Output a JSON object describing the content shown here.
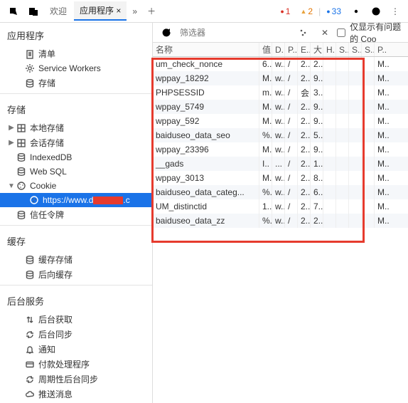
{
  "toolbar": {
    "tab_welcome": "欢迎",
    "tab_app": "应用程序",
    "tab_close": "×",
    "err_count": "1",
    "warn_count": "2",
    "msg_count": "33"
  },
  "sidebar": {
    "app": {
      "title": "应用程序",
      "items": [
        {
          "label": "清单",
          "icon": "manifest"
        },
        {
          "label": "Service Workers",
          "icon": "gear"
        },
        {
          "label": "存储",
          "icon": "db"
        }
      ]
    },
    "storage": {
      "title": "存储",
      "items": [
        {
          "label": "本地存储",
          "icon": "grid",
          "twist": "▶"
        },
        {
          "label": "会话存储",
          "icon": "grid",
          "twist": "▶"
        },
        {
          "label": "IndexedDB",
          "icon": "db",
          "twist": ""
        },
        {
          "label": "Web SQL",
          "icon": "db",
          "twist": ""
        },
        {
          "label": "Cookie",
          "icon": "cookie",
          "twist": "▼"
        },
        {
          "label": "https://www.d",
          "label_suffix": ".c",
          "icon": "cookie",
          "twist": "",
          "selected": true,
          "redacted": true
        },
        {
          "label": "信任令牌",
          "icon": "db",
          "twist": ""
        }
      ]
    },
    "cache": {
      "title": "缓存",
      "items": [
        {
          "label": "缓存存储",
          "icon": "db"
        },
        {
          "label": "后向缓存",
          "icon": "db"
        }
      ]
    },
    "bg": {
      "title": "后台服务",
      "items": [
        {
          "label": "后台获取",
          "icon": "updown"
        },
        {
          "label": "后台同步",
          "icon": "sync"
        },
        {
          "label": "通知",
          "icon": "bell"
        },
        {
          "label": "付款处理程序",
          "icon": "card"
        },
        {
          "label": "周期性后台同步",
          "icon": "sync"
        },
        {
          "label": "推送消息",
          "icon": "cloud"
        }
      ]
    }
  },
  "filter": {
    "placeholder": "筛选器",
    "only_issues": "仅显示有问题的 Coo"
  },
  "table": {
    "cols": [
      "名称",
      "值",
      "D..",
      "P..",
      "E..",
      "大..",
      "H..",
      "S..",
      "S..",
      "S..",
      "P.."
    ],
    "rows": [
      {
        "n": "um_check_nonce",
        "c": [
          "6..",
          "w..",
          "/",
          "2..",
          "2..",
          "",
          "",
          "",
          "",
          "M.."
        ]
      },
      {
        "n": "wppay_18292",
        "c": [
          "M..",
          "w..",
          "/",
          "2..",
          "9..",
          "",
          "",
          "",
          "",
          "M.."
        ]
      },
      {
        "n": "PHPSESSID",
        "c": [
          "m..",
          "w..",
          "/",
          "会..",
          "3..",
          "",
          "",
          "",
          "",
          "M.."
        ]
      },
      {
        "n": "wppay_5749",
        "c": [
          "M..",
          "w..",
          "/",
          "2..",
          "9..",
          "",
          "",
          "",
          "",
          "M.."
        ]
      },
      {
        "n": "wppay_592",
        "c": [
          "M..",
          "w..",
          "/",
          "2..",
          "9..",
          "",
          "",
          "",
          "",
          "M.."
        ]
      },
      {
        "n": "baiduseo_data_seo",
        "c": [
          "%..",
          "w..",
          "/",
          "2..",
          "5..",
          "",
          "",
          "",
          "",
          "M.."
        ]
      },
      {
        "n": "wppay_23396",
        "c": [
          "M..",
          "w..",
          "/",
          "2..",
          "9..",
          "",
          "",
          "",
          "",
          "M.."
        ]
      },
      {
        "n": "__gads",
        "c": [
          "I..",
          "...",
          "/",
          "2..",
          "1..",
          "",
          "",
          "",
          "",
          "M.."
        ]
      },
      {
        "n": "wppay_3013",
        "c": [
          "M..",
          "w..",
          "/",
          "2..",
          "8..",
          "",
          "",
          "",
          "",
          "M.."
        ]
      },
      {
        "n": "baiduseo_data_categ...",
        "c": [
          "%..",
          "w..",
          "/",
          "2..",
          "6..",
          "",
          "",
          "",
          "",
          "M.."
        ]
      },
      {
        "n": "UM_distinctid",
        "c": [
          "1..",
          "w..",
          "/",
          "2..",
          "7..",
          "",
          "",
          "",
          "",
          "M.."
        ]
      },
      {
        "n": "baiduseo_data_zz",
        "c": [
          "%..",
          "w..",
          "/",
          "2..",
          "2..",
          "",
          "",
          "",
          "",
          "M.."
        ]
      }
    ]
  }
}
